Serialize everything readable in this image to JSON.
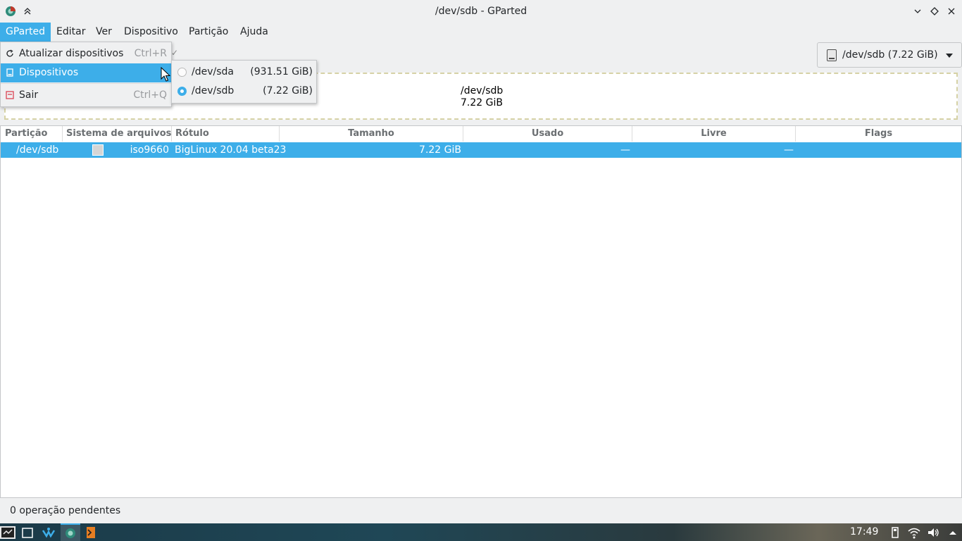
{
  "window": {
    "title": "/dev/sdb - GParted"
  },
  "menubar": {
    "items": [
      {
        "label": "GParted"
      },
      {
        "label": "Editar"
      },
      {
        "label": "Ver"
      },
      {
        "label": "Dispositivo"
      },
      {
        "label": "Partição"
      },
      {
        "label": "Ajuda"
      }
    ]
  },
  "gparted_menu": {
    "refresh": {
      "label": "Atualizar dispositivos",
      "shortcut": "Ctrl+R"
    },
    "devices": {
      "label": "Dispositivos"
    },
    "quit": {
      "label": "Sair",
      "shortcut": "Ctrl+Q"
    }
  },
  "devices_submenu": [
    {
      "device": "/dev/sda",
      "size": "(931.51 GiB)",
      "selected": false
    },
    {
      "device": "/dev/sdb",
      "size": "(7.22 GiB)",
      "selected": true
    }
  ],
  "device_combo": {
    "label": "/dev/sdb (7.22 GiB)"
  },
  "disk_visual": {
    "name": "/dev/sdb",
    "size": "7.22 GiB"
  },
  "table": {
    "columns": [
      "Partição",
      "Sistema de arquivos",
      "Rótulo",
      "Tamanho",
      "Usado",
      "Livre",
      "Flags"
    ],
    "rows": [
      {
        "partition": "/dev/sdb",
        "filesystem": "iso9660",
        "label": "BigLinux 20.04 beta23",
        "size": "7.22 GiB",
        "used": "—",
        "free": "—",
        "flags": ""
      }
    ]
  },
  "status": {
    "text": "0 operação pendentes"
  },
  "taskbar": {
    "clock": "17:49"
  },
  "colors": {
    "accent": "#3daee9",
    "window_bg": "#eff0f1",
    "fs_swatch": "#d5d5d5"
  }
}
